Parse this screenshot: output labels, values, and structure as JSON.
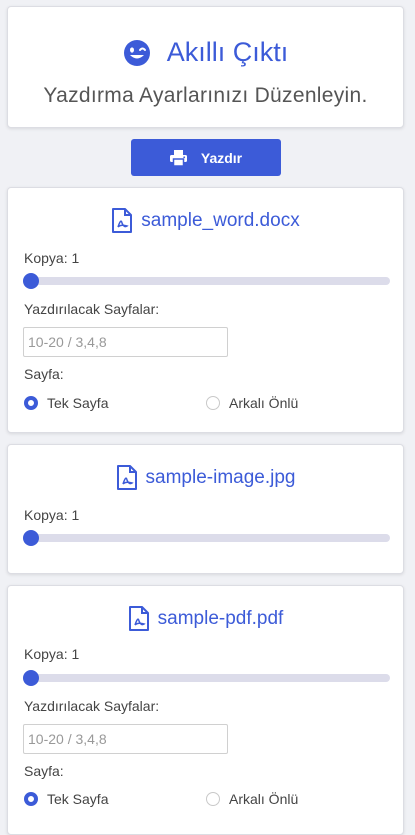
{
  "app": {
    "title": "Akıllı Çıktı",
    "subtitle": "Yazdırma Ayarlarınızı Düzenleyin."
  },
  "print_button": {
    "label": "Yazdır"
  },
  "colors": {
    "accent": "#3c5bd8",
    "background": "#f0f1f5",
    "track": "#dcdcea"
  },
  "files": [
    {
      "name": "sample_word.docx",
      "copies_label": "Kopya: 1",
      "copies_value": 1,
      "pages_label": "Yazdırılacak Sayfalar:",
      "pages_placeholder": "10-20 / 3,4,8",
      "side_label": "Sayfa:",
      "options": [
        "Tek Sayfa",
        "Arkalı Önlü"
      ],
      "selected": "Tek Sayfa"
    },
    {
      "name": "sample-image.jpg",
      "copies_label": "Kopya: 1",
      "copies_value": 1
    },
    {
      "name": "sample-pdf.pdf",
      "copies_label": "Kopya: 1",
      "copies_value": 1,
      "pages_label": "Yazdırılacak Sayfalar:",
      "pages_placeholder": "10-20 / 3,4,8",
      "side_label": "Sayfa:",
      "options": [
        "Tek Sayfa",
        "Arkalı Önlü"
      ],
      "selected": "Tek Sayfa"
    }
  ],
  "icons": {
    "logo": "smile-wink-icon",
    "print": "printer-icon",
    "file": "file-pdf-icon"
  }
}
